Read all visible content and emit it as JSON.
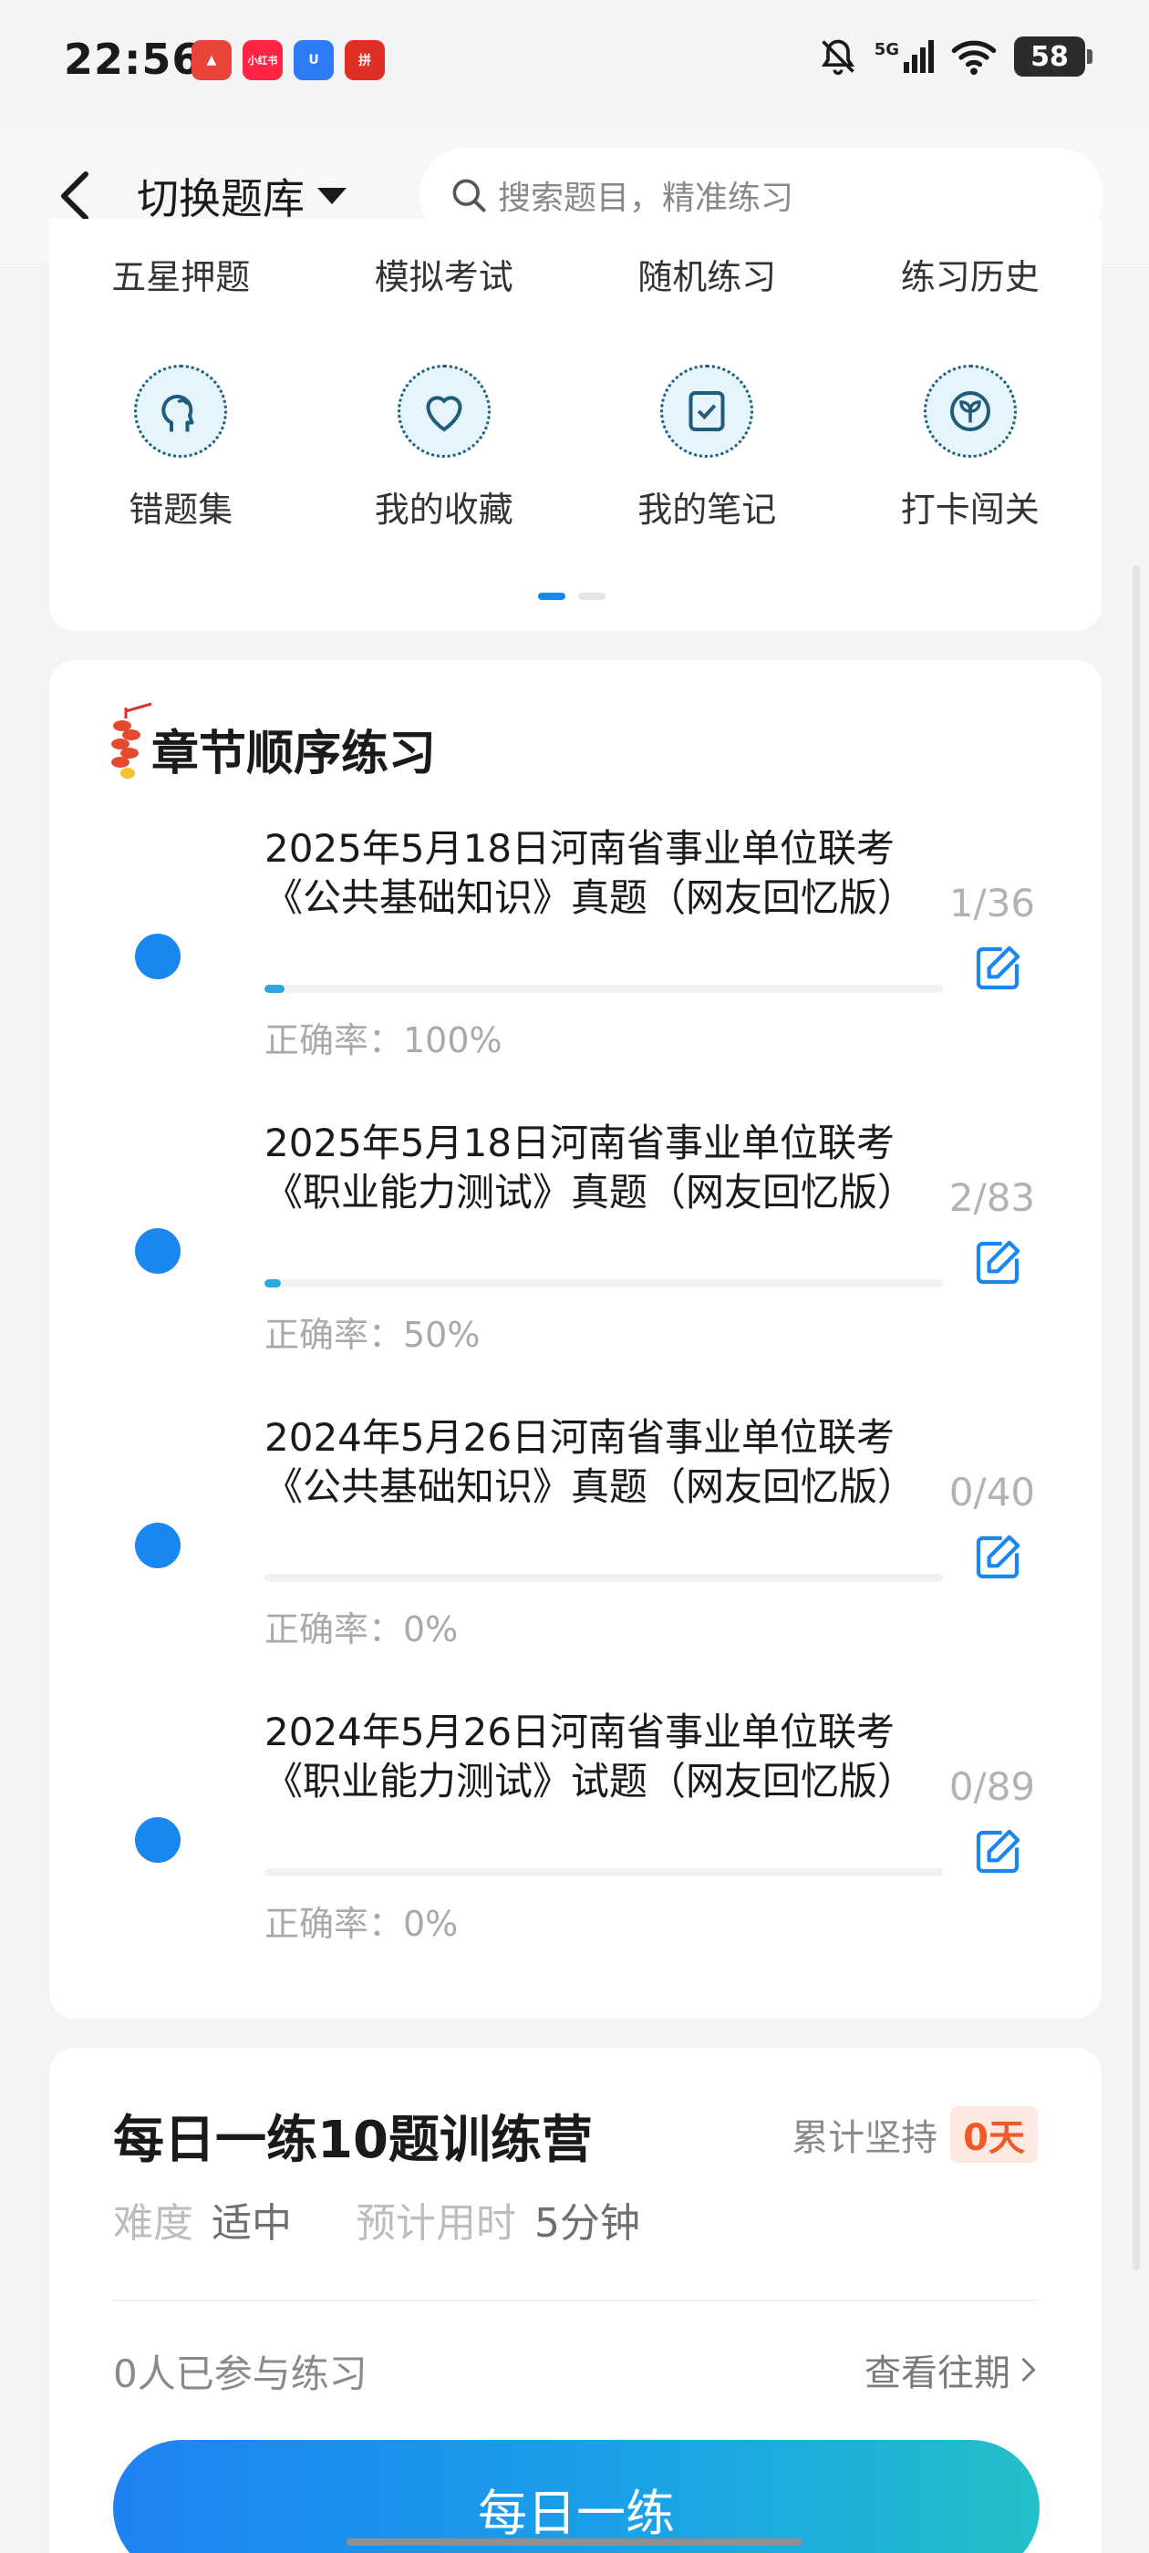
{
  "status_bar": {
    "time": "22:56",
    "apps": [
      {
        "name": "app-icon-1",
        "label": "▲",
        "color": "#e8443a"
      },
      {
        "name": "app-icon-2",
        "label": "小红书",
        "color": "#ff2442"
      },
      {
        "name": "app-icon-3",
        "label": "U",
        "color": "#2e7bf6"
      },
      {
        "name": "app-icon-4",
        "label": "拼",
        "color": "#e02e24"
      }
    ],
    "network": "5G",
    "battery": "58"
  },
  "header": {
    "switch_label": "切换题库",
    "search_placeholder": "搜索题目，精准练习"
  },
  "quick_grid": {
    "row1": [
      "五星押题",
      "模拟考试",
      "随机练习",
      "练习历史"
    ],
    "row2": [
      {
        "label": "错题集",
        "icon": "head-profile-icon"
      },
      {
        "label": "我的收藏",
        "icon": "heart-icon"
      },
      {
        "label": "我的笔记",
        "icon": "note-check-icon"
      },
      {
        "label": "打卡闯关",
        "icon": "sprout-icon"
      }
    ]
  },
  "chapter": {
    "title": "章节顺序练习",
    "items": [
      {
        "name": "2025年5月18日河南省事业单位联考《公共基础知识》真题（网友回忆版）",
        "count": "1/36",
        "accuracy": "正确率：100%",
        "progress": 0.03
      },
      {
        "name": "2025年5月18日河南省事业单位联考《职业能力测试》真题（网友回忆版）",
        "count": "2/83",
        "accuracy": "正确率：50%",
        "progress": 0.024
      },
      {
        "name": "2024年5月26日河南省事业单位联考《公共基础知识》真题（网友回忆版）",
        "count": "0/40",
        "accuracy": "正确率：0%",
        "progress": 0
      },
      {
        "name": "2024年5月26日河南省事业单位联考《职业能力测试》试题（网友回忆版）",
        "count": "0/89",
        "accuracy": "正确率：0%",
        "progress": 0
      }
    ]
  },
  "daily": {
    "title": "每日一练10题训练营",
    "persist_label": "累计坚持",
    "persist_days": "0天",
    "difficulty_label": "难度",
    "difficulty_value": "适中",
    "time_label": "预计用时",
    "time_value": "5分钟",
    "participants": "0人已参与练习",
    "history_link": "查看往期",
    "cta": "每日一练"
  }
}
